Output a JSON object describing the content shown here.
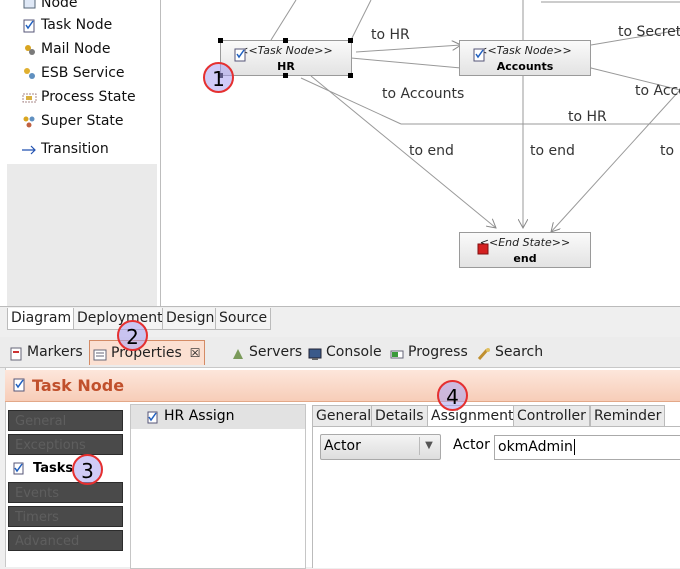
{
  "palette": {
    "items": [
      {
        "label": "Node",
        "icon": "node-icon"
      },
      {
        "label": "Task Node",
        "icon": "task-node-icon"
      },
      {
        "label": "Mail Node",
        "icon": "mail-node-icon"
      },
      {
        "label": "ESB Service",
        "icon": "esb-service-icon"
      },
      {
        "label": "Process State",
        "icon": "process-state-icon"
      },
      {
        "label": "Super State",
        "icon": "super-state-icon"
      },
      {
        "label": "Transition",
        "icon": "transition-arrow-icon"
      }
    ]
  },
  "diagram": {
    "nodes": [
      {
        "stereotype": "<<Task Node>>",
        "name": "HR"
      },
      {
        "stereotype": "<<Task Node>>",
        "name": "Accounts"
      },
      {
        "stereotype": "<<End State>>",
        "name": "end"
      }
    ],
    "transition_labels": [
      "to HR",
      "to Secret",
      "to Accounts",
      "to Acco",
      "to HR",
      "to end",
      "to end",
      "to"
    ]
  },
  "editor_tabs": [
    "Diagram",
    "Deployment",
    "Design",
    "Source"
  ],
  "view_tabs": [
    "Markers",
    "Properties",
    "Servers",
    "Console",
    "Progress",
    "Search"
  ],
  "properties": {
    "title": "Task Node",
    "side_tabs": [
      "General",
      "Exceptions",
      "Tasks",
      "Events",
      "Timers",
      "Advanced"
    ],
    "task_list": [
      "HR Assign"
    ],
    "inner_tabs": [
      "General",
      "Details",
      "Assignment",
      "Controller",
      "Reminder"
    ],
    "assignment": {
      "type_value": "Actor",
      "actor_label": "Actor",
      "actor_value": "okmAdmin"
    }
  },
  "annotations": [
    "1",
    "2",
    "3",
    "4"
  ],
  "colors": {
    "accent": "#c0502c",
    "header_bg": "#fbe0d2",
    "badge_border": "#e53030",
    "badge_fill": "#aaa0f0"
  }
}
